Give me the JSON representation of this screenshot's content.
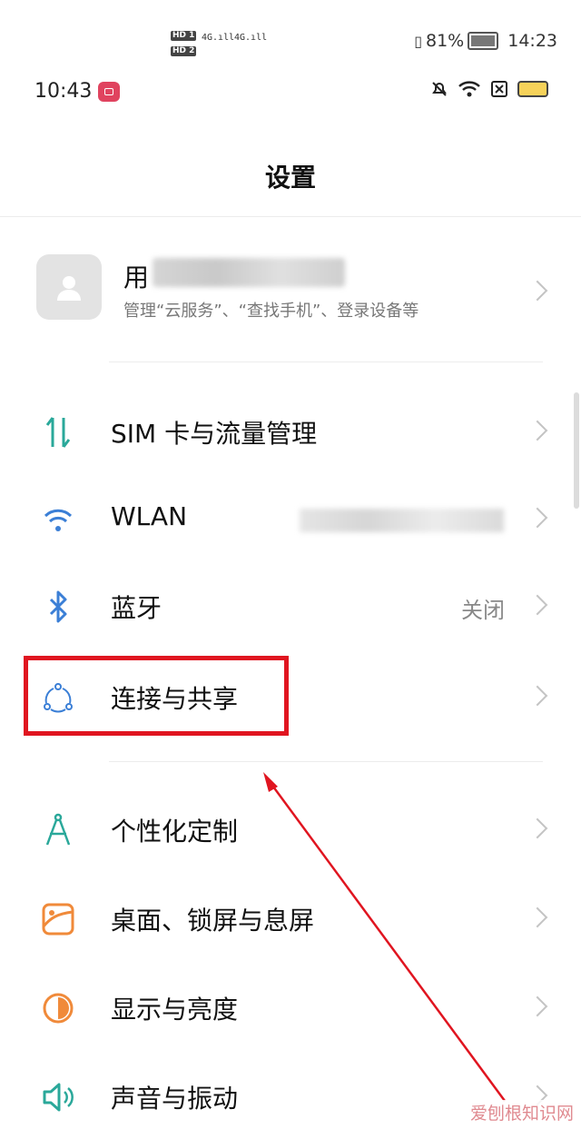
{
  "host_status": {
    "hd1": "HD 1",
    "hd2": "HD 2",
    "sig1": "4G.ıll",
    "sig2": "4G.ıll",
    "battery_pct": "81%",
    "time": "14:23"
  },
  "phone_status": {
    "time": "10:43",
    "battery_level": 1.0,
    "battery_color": "#f6d25a"
  },
  "page": {
    "title": "设置"
  },
  "account": {
    "name_visible": "用",
    "subtitle": "管理“云服务”、“查找手机”、登录设备等"
  },
  "settings": [
    {
      "label": "SIM 卡与流量管理",
      "value": "",
      "icon": "sim-data-icon",
      "color": "#2aa89a"
    },
    {
      "label": "WLAN",
      "value": "",
      "icon": "wifi-icon",
      "color": "#3b7fd6"
    },
    {
      "label": "蓝牙",
      "value": "关闭",
      "icon": "bluetooth-icon",
      "color": "#3b7fd6"
    },
    {
      "label": "连接与共享",
      "value": "",
      "icon": "connection-share-icon",
      "color": "#3b7fd6"
    },
    {
      "label": "个性化定制",
      "value": "",
      "icon": "personalize-icon",
      "color": "#2aa89a"
    },
    {
      "label": "桌面、锁屏与息屏",
      "value": "",
      "icon": "wallpaper-icon",
      "color": "#f08a3a"
    },
    {
      "label": "显示与亮度",
      "value": "",
      "icon": "brightness-icon",
      "color": "#f08a3a"
    },
    {
      "label": "声音与振动",
      "value": "",
      "icon": "sound-icon",
      "color": "#2aa89a"
    }
  ],
  "annotation": {
    "highlight_color": "#e01520"
  },
  "watermark": "爱刨根知识网"
}
